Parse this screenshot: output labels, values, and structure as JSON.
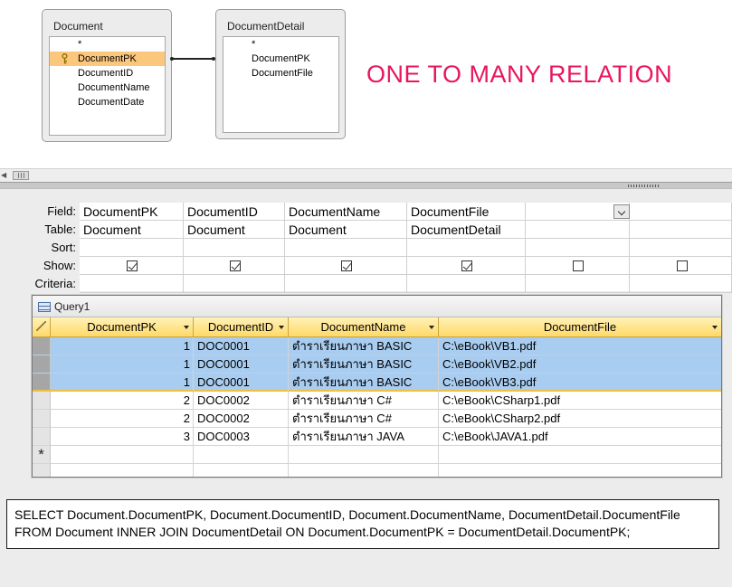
{
  "diagram": {
    "headline": "ONE TO MANY RELATION",
    "tables": [
      {
        "title": "Document",
        "fields": [
          "*",
          "DocumentPK",
          "DocumentID",
          "DocumentName",
          "DocumentDate"
        ],
        "selected_index": 1,
        "key_index": 1
      },
      {
        "title": "DocumentDetail",
        "fields": [
          "*",
          "DocumentPK",
          "DocumentFile"
        ],
        "selected_index": -1
      }
    ]
  },
  "design_grid": {
    "row_labels": [
      "Field:",
      "Table:",
      "Sort:",
      "Show:",
      "Criteria:"
    ],
    "columns": [
      {
        "field": "DocumentPK",
        "table": "Document",
        "show": true
      },
      {
        "field": "DocumentID",
        "table": "Document",
        "show": true
      },
      {
        "field": "DocumentName",
        "table": "Document",
        "show": true
      },
      {
        "field": "DocumentFile",
        "table": "DocumentDetail",
        "show": true
      },
      {
        "field": "",
        "table": "",
        "show": false
      },
      {
        "field": "",
        "table": "",
        "show": false
      }
    ]
  },
  "query_window": {
    "title": "Query1",
    "headers": [
      "DocumentPK",
      "DocumentID",
      "DocumentName",
      "DocumentFile"
    ],
    "rows": [
      [
        "1",
        "DOC0001",
        "ตำราเรียนภาษา BASIC",
        "C:\\eBook\\VB1.pdf"
      ],
      [
        "1",
        "DOC0001",
        "ตำราเรียนภาษา BASIC",
        "C:\\eBook\\VB2.pdf"
      ],
      [
        "1",
        "DOC0001",
        "ตำราเรียนภาษา BASIC",
        "C:\\eBook\\VB3.pdf"
      ],
      [
        "2",
        "DOC0002",
        "ตำราเรียนภาษา C#",
        "C:\\eBook\\CSharp1.pdf"
      ],
      [
        "2",
        "DOC0002",
        "ตำราเรียนภาษา C#",
        "C:\\eBook\\CSharp2.pdf"
      ],
      [
        "3",
        "DOC0003",
        "ตำราเรียนภาษา JAVA",
        "C:\\eBook\\JAVA1.pdf"
      ]
    ],
    "selected_rows": [
      0,
      1,
      2
    ],
    "new_row_marker": "*"
  },
  "sql": {
    "line1": "SELECT Document.DocumentPK, Document.DocumentID, Document.DocumentName, DocumentDetail.DocumentFile",
    "line2": "FROM Document INNER JOIN DocumentDetail ON Document.DocumentPK = DocumentDetail.DocumentPK;"
  },
  "colors": {
    "headline": "#e8175d",
    "selected_field": "#fbc77d",
    "selected_row": "#a9cdf0",
    "header_gold": "#ffd966"
  },
  "icons": {
    "primary_key": "key-icon",
    "query_window": "datasheet-icon",
    "dropdown": "chevron-down-icon"
  }
}
